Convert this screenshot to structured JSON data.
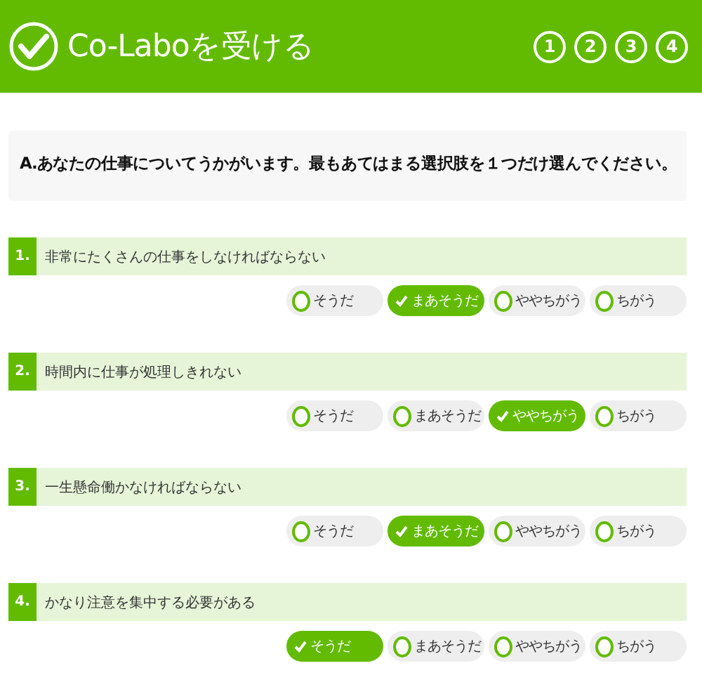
{
  "header": {
    "title": "Co-Laboを受ける",
    "steps": [
      "1",
      "2",
      "3",
      "4"
    ]
  },
  "prompt": "A.あなたの仕事についてうかがいます。最もあてはまる選択肢を１つだけ選んでください。",
  "questions": [
    {
      "number": "1.",
      "text": "非常にたくさんの仕事をしなければならない",
      "options": [
        {
          "label": "そうだ",
          "selected": false
        },
        {
          "label": "まあそうだ",
          "selected": true
        },
        {
          "label": "ややちがう",
          "selected": false
        },
        {
          "label": "ちがう",
          "selected": false
        }
      ]
    },
    {
      "number": "2.",
      "text": "時間内に仕事が処理しきれない",
      "options": [
        {
          "label": "そうだ",
          "selected": false
        },
        {
          "label": "まあそうだ",
          "selected": false
        },
        {
          "label": "ややちがう",
          "selected": true
        },
        {
          "label": "ちがう",
          "selected": false
        }
      ]
    },
    {
      "number": "3.",
      "text": "一生懸命働かなければならない",
      "options": [
        {
          "label": "そうだ",
          "selected": false
        },
        {
          "label": "まあそうだ",
          "selected": true
        },
        {
          "label": "ややちがう",
          "selected": false
        },
        {
          "label": "ちがう",
          "selected": false
        }
      ]
    },
    {
      "number": "4.",
      "text": "かなり注意を集中する必要がある",
      "options": [
        {
          "label": "そうだ",
          "selected": true
        },
        {
          "label": "まあそうだ",
          "selected": false
        },
        {
          "label": "ややちがう",
          "selected": false
        },
        {
          "label": "ちがう",
          "selected": false
        }
      ]
    }
  ]
}
